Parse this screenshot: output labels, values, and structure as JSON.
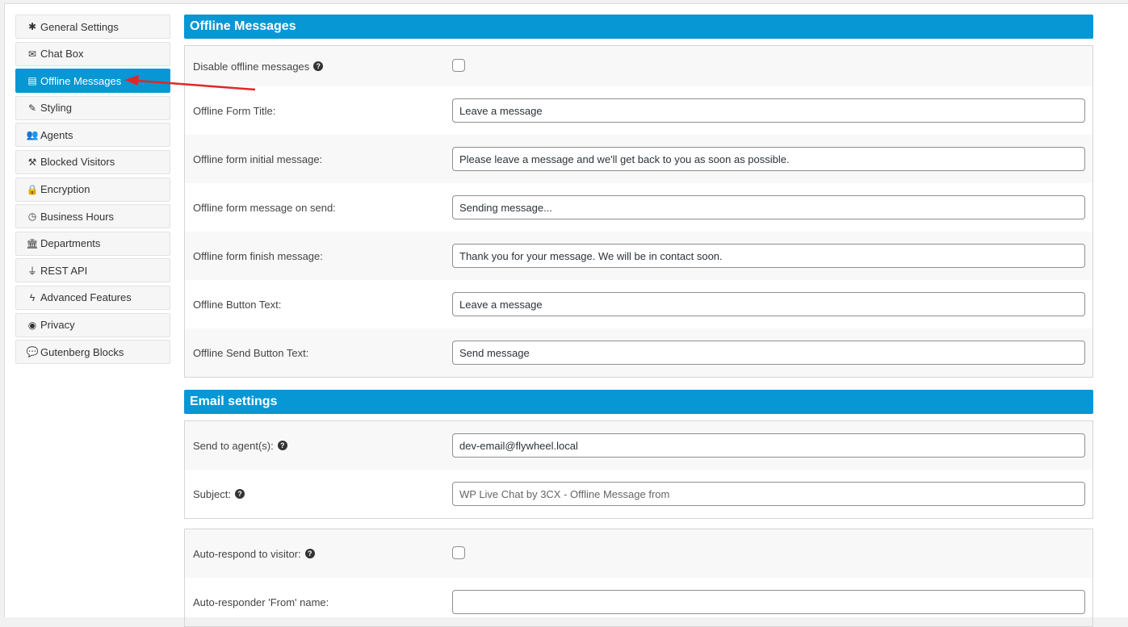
{
  "sidebar": {
    "items": [
      {
        "label": "General Settings",
        "icon": "gear-icon",
        "active": false
      },
      {
        "label": "Chat Box",
        "icon": "envelope-icon",
        "active": false
      },
      {
        "label": "Offline Messages",
        "icon": "book-icon",
        "active": true
      },
      {
        "label": "Styling",
        "icon": "pencil-icon",
        "active": false
      },
      {
        "label": "Agents",
        "icon": "users-icon",
        "active": false
      },
      {
        "label": "Blocked Visitors",
        "icon": "gavel-icon",
        "active": false
      },
      {
        "label": "Encryption",
        "icon": "lock-icon",
        "active": false
      },
      {
        "label": "Business Hours",
        "icon": "clock-icon",
        "active": false
      },
      {
        "label": "Departments",
        "icon": "university-icon",
        "active": false
      },
      {
        "label": "REST API",
        "icon": "plug-icon",
        "active": false
      },
      {
        "label": "Advanced Features",
        "icon": "bolt-icon",
        "active": false
      },
      {
        "label": "Privacy",
        "icon": "eye-icon",
        "active": false
      },
      {
        "label": "Gutenberg Blocks",
        "icon": "comment-icon",
        "active": false
      }
    ]
  },
  "offline_messages": {
    "title": "Offline Messages",
    "disable_label": "Disable offline messages",
    "disable_checked": false,
    "form_title_label": "Offline Form Title:",
    "form_title_value": "Leave a message",
    "initial_message_label": "Offline form initial message:",
    "initial_message_value": "Please leave a message and we'll get back to you as soon as possible.",
    "on_send_label": "Offline form message on send:",
    "on_send_value": "Sending message...",
    "finish_label": "Offline form finish message:",
    "finish_value": "Thank you for your message. We will be in contact soon.",
    "button_text_label": "Offline Button Text:",
    "button_text_value": "Leave a message",
    "send_button_label": "Offline Send Button Text:",
    "send_button_value": "Send message"
  },
  "email_settings": {
    "title": "Email settings",
    "send_to_label": "Send to agent(s):",
    "send_to_value": "dev-email@flywheel.local",
    "subject_label": "Subject:",
    "subject_value": "WP Live Chat by 3CX - Offline Message from"
  },
  "auto_respond": {
    "label": "Auto-respond to visitor:",
    "checked": false,
    "from_name_label": "Auto-responder 'From' name:",
    "from_name_value": ""
  },
  "colors": {
    "accent": "#0697d4",
    "annotation_arrow": "#e32626"
  }
}
